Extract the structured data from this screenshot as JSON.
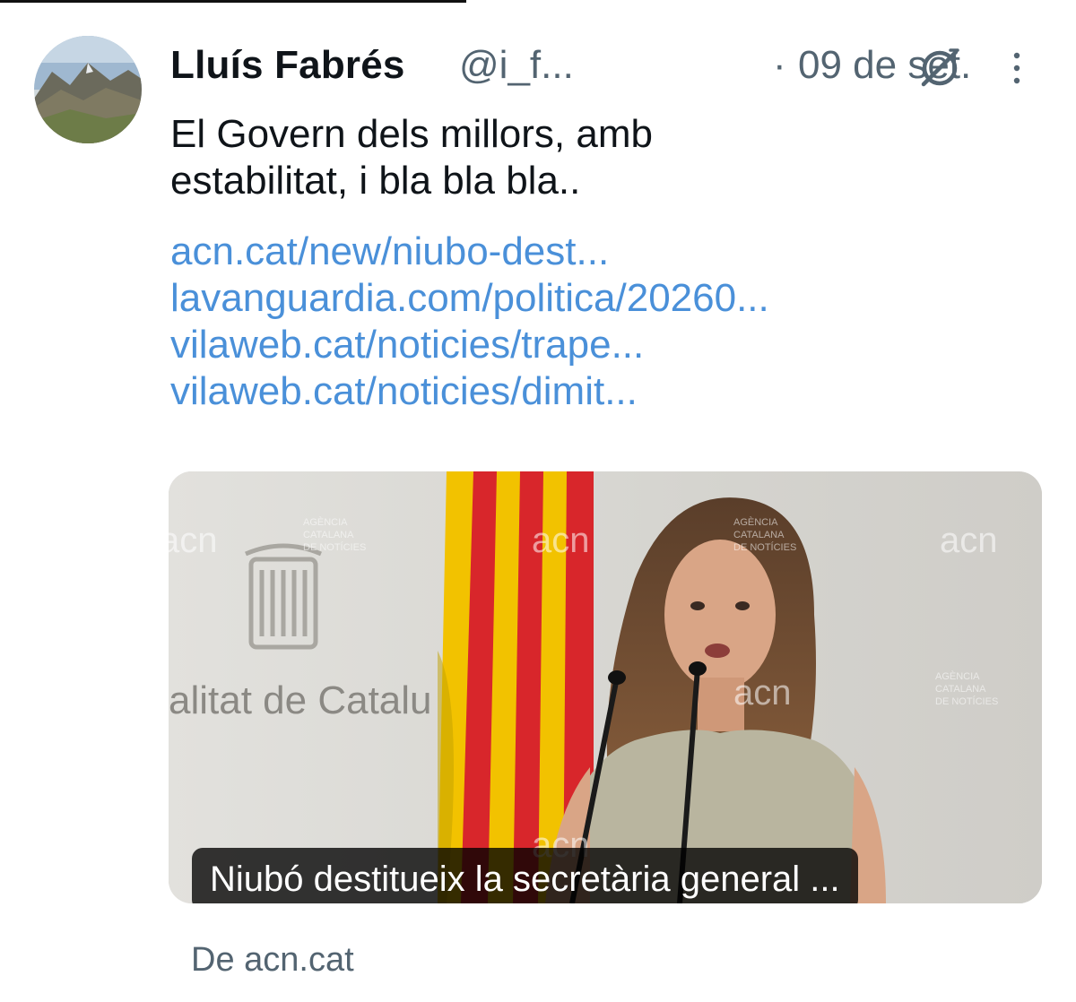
{
  "post": {
    "author_name": "Lluís Fabrés",
    "author_handle": "@i_f...",
    "separator": "·",
    "date": "09 de set.",
    "text_lines": [
      "El Govern dels millors, amb",
      "estabilitat, i bla bla bla.."
    ],
    "links": [
      "acn.cat/new/niubo-dest...",
      "lavanguardia.com/politica/20260...",
      "vilaweb.cat/noticies/trape...",
      "vilaweb.cat/noticies/dimit..."
    ]
  },
  "card": {
    "caption": "Niubó destitueix la secretària general ...",
    "source": "De acn.cat",
    "image": {
      "watermark_logo": "acn",
      "watermark_text_lines": [
        "AGÈNCIA",
        "CATALANA",
        "DE NOTÍCIES"
      ],
      "backdrop_text": "alitat de Catalu"
    }
  },
  "icons": {
    "grok": "grok-icon",
    "more": "more-vertical-icon",
    "avatar": "avatar-mountain-photo"
  },
  "colors": {
    "text": "#0f1419",
    "muted": "#536471",
    "link": "#4a90d9",
    "flag_yellow": "#f2c200",
    "flag_red": "#d8262b"
  }
}
